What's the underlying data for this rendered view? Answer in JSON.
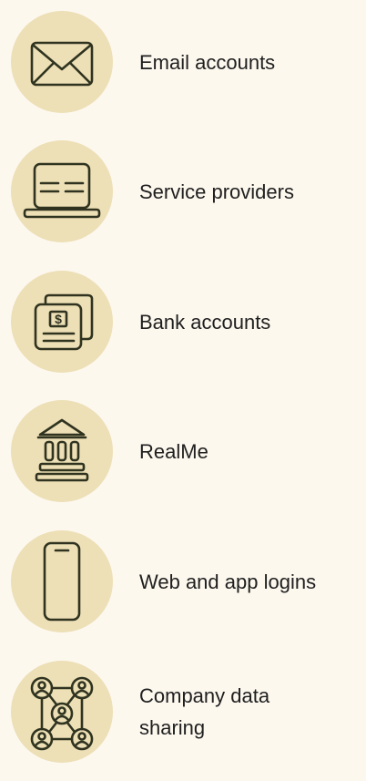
{
  "items": [
    {
      "label": "Email accounts",
      "icon": "envelope-icon"
    },
    {
      "label": "Service providers",
      "icon": "laptop-icon"
    },
    {
      "label": "Bank accounts",
      "icon": "bank-statement-icon"
    },
    {
      "label": "RealMe",
      "icon": "government-building-icon"
    },
    {
      "label": "Web and app logins",
      "icon": "mobile-phone-icon"
    },
    {
      "label": "Company data sharing",
      "icon": "people-network-icon"
    }
  ],
  "colors": {
    "background": "#fcf8ee",
    "icon_circle": "#eddfb6",
    "icon_stroke": "#2f331f",
    "text": "#1f1f1f"
  }
}
